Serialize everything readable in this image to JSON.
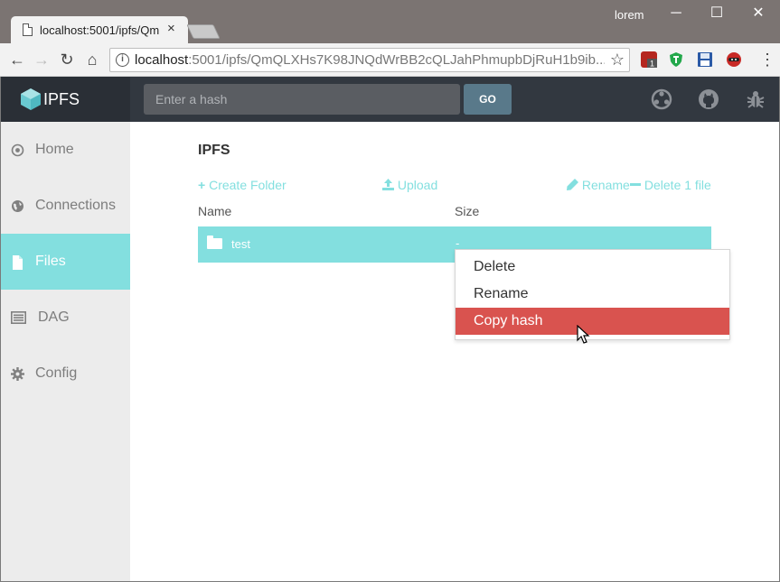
{
  "browser": {
    "tab_title": "localhost:5001/ipfs/Qm",
    "tab_close": "×",
    "profile": "lorem",
    "win_minimize": "─",
    "win_maximize": "☐",
    "win_close": "✕",
    "url_host": "localhost",
    "url_rest": ":5001/ipfs/QmQLXHs7K98JNQdWrBB2cQLJahPhmupbDjRuH1b9ib...",
    "nav": {
      "back": "←",
      "forward": "→",
      "reload": "↻",
      "home": "⌂"
    },
    "star": "☆",
    "menu": "⋮",
    "extensions": [
      {
        "name": "ublock-icon",
        "color": "#b5271f"
      },
      {
        "name": "shield-icon",
        "color": "#23a84b"
      },
      {
        "name": "save-icon",
        "color": "#2b5aa6"
      },
      {
        "name": "ninja-icon",
        "color": "#c82a26"
      }
    ]
  },
  "app": {
    "brand": "IPFS",
    "search": {
      "placeholder": "Enter a hash",
      "go_label": "GO"
    },
    "header_icons": [
      "network-icon",
      "github-icon",
      "bug-icon"
    ]
  },
  "sidebar": {
    "items": [
      {
        "label": "Home",
        "icon": "home-icon",
        "active": false
      },
      {
        "label": "Connections",
        "icon": "globe-icon",
        "active": false
      },
      {
        "label": "Files",
        "icon": "file-icon",
        "active": true
      },
      {
        "label": "DAG",
        "icon": "list-icon",
        "active": false
      },
      {
        "label": "Config",
        "icon": "gear-icon",
        "active": false
      }
    ]
  },
  "main": {
    "title": "IPFS",
    "actions": {
      "create_folder": "Create Folder",
      "upload": "Upload",
      "rename": "Rename",
      "delete": "Delete 1 file"
    },
    "columns": {
      "name": "Name",
      "size": "Size"
    },
    "files": [
      {
        "name": "test",
        "size": "-",
        "type": "folder",
        "selected": true
      }
    ]
  },
  "context_menu": {
    "items": [
      {
        "label": "Delete",
        "highlighted": false
      },
      {
        "label": "Rename",
        "highlighted": false
      },
      {
        "label": "Copy hash",
        "highlighted": true
      }
    ]
  },
  "colors": {
    "accent": "#83dfdf",
    "header_bg": "#323840",
    "go_button": "#59798a",
    "danger": "#d9534f"
  }
}
